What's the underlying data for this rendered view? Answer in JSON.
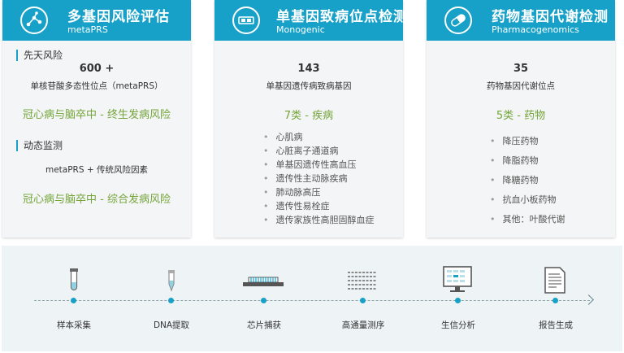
{
  "cards": [
    {
      "title": "多基因风险评估",
      "subtitle": "metaPRS",
      "icon": "network-nodes-icon",
      "section1_label": "先天风险",
      "section1_count": "600 +",
      "section1_desc": "单核苷酸多态性位点（metaPRS）",
      "section1_highlight": "冠心病与脑卒中 - 终生发病风险",
      "section2_label": "动态监测",
      "section2_desc": "metaPRS + 传统风险因素",
      "section2_highlight": "冠心病与脑卒中 - 综合发病风险"
    },
    {
      "title": "单基因致病位点检测",
      "subtitle": "Monogenic",
      "icon": "gene-chip-icon",
      "count": "143",
      "desc": "单基因遗传病致病基因",
      "highlight": "7类 - 疾病",
      "items": [
        "心肌病",
        "心脏离子通道病",
        "单基因遗传性高血压",
        "遗传性主动脉疾病",
        "肺动脉高压",
        "遗传性易栓症",
        "遗传家族性高胆固醇血症"
      ]
    },
    {
      "title": "药物基因代谢检测",
      "subtitle": "Pharmacogenomics",
      "icon": "pill-capsule-icon",
      "count": "35",
      "desc": "药物基因代谢位点",
      "highlight": "5类 - 药物",
      "items": [
        "降压药物",
        "降脂药物",
        "降糖药物",
        "抗血小板药物",
        "其他：叶酸代谢"
      ]
    }
  ],
  "steps": [
    {
      "label": "样本采集",
      "icon": "test-tube-icon"
    },
    {
      "label": "DNA提取",
      "icon": "dna-tube-icon"
    },
    {
      "label": "芯片捕获",
      "icon": "chip-icon"
    },
    {
      "label": "高通量测序",
      "icon": "sequence-lines-icon"
    },
    {
      "label": "生信分析",
      "icon": "monitor-icon"
    },
    {
      "label": "报告生成",
      "icon": "report-document-icon"
    }
  ],
  "colors": {
    "accent": "#17a1c8",
    "highlight_green": "#74a43a",
    "panel_bg": "#f4f5f6",
    "bottom_bg": "#eef4f6"
  }
}
